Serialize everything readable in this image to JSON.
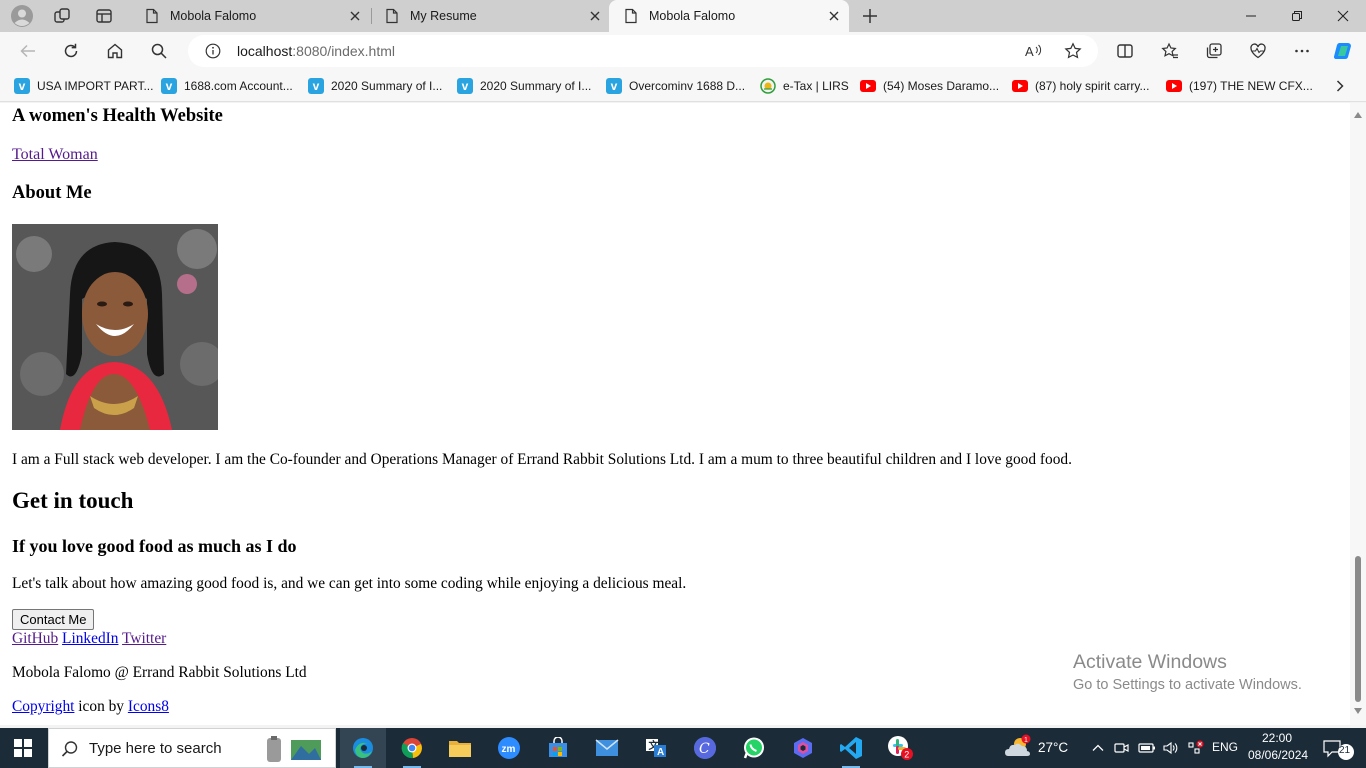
{
  "browser": {
    "tabs": [
      {
        "title": "Mobola Falomo",
        "active": false
      },
      {
        "title": "My Resume",
        "active": false
      },
      {
        "title": "Mobola Falomo",
        "active": true
      }
    ],
    "address": {
      "host": "localhost",
      "rest": ":8080/index.html"
    },
    "bookmarks": [
      {
        "label": "USA IMPORT PART...",
        "icon": "vimeo-icon"
      },
      {
        "label": "1688.com Account...",
        "icon": "vimeo-icon"
      },
      {
        "label": "2020 Summary of I...",
        "icon": "vimeo-icon"
      },
      {
        "label": "2020 Summary of I...",
        "icon": "vimeo-icon"
      },
      {
        "label": "Overcominv 1688 D...",
        "icon": "vimeo-icon"
      },
      {
        "label": "e-Tax | LIRS",
        "icon": "lirs-icon"
      },
      {
        "label": "(54) Moses Daramo...",
        "icon": "youtube-icon"
      },
      {
        "label": "(87) holy spirit carry...",
        "icon": "youtube-icon"
      },
      {
        "label": "(197) THE NEW CFX...",
        "icon": "youtube-icon"
      }
    ]
  },
  "page": {
    "site_heading": "A women's Health Website",
    "site_link": "Total Woman",
    "about_heading": "About Me",
    "bio": "I am a Full stack web developer. I am the Co-founder and Operations Manager of Errand Rabbit Solutions Ltd. I am a mum to three beautiful children and I love good food.",
    "contact_heading": "Get in touch",
    "contact_subheading": "If you love good food as much as I do",
    "contact_text": "Let's talk about how amazing good food is, and we can get into some coding while enjoying a delicious meal.",
    "contact_button": "Contact Me",
    "social_links": {
      "github": "GitHub",
      "linkedin": "LinkedIn",
      "twitter": "Twitter"
    },
    "footer_credit": "Mobola Falomo @ Errand Rabbit Solutions Ltd",
    "copyright_link": "Copyright",
    "copyright_middle": " icon by ",
    "icons8_link": "Icons8"
  },
  "watermark": {
    "title": "Activate Windows",
    "subtitle": "Go to Settings to activate Windows."
  },
  "taskbar": {
    "search_placeholder": "Type here to search",
    "weather_temp": "27°C",
    "language": "ENG",
    "time": "22:00",
    "date": "08/06/2024",
    "notification_count": "21",
    "teams_badge": "2",
    "weather_badge": "1"
  },
  "colors": {
    "tabstrip": "#cfcfcf",
    "toolbar": "#f7f7f7",
    "taskbar": "#1b2b38",
    "visited_link": "#551a8b",
    "link": "#0000ee"
  }
}
